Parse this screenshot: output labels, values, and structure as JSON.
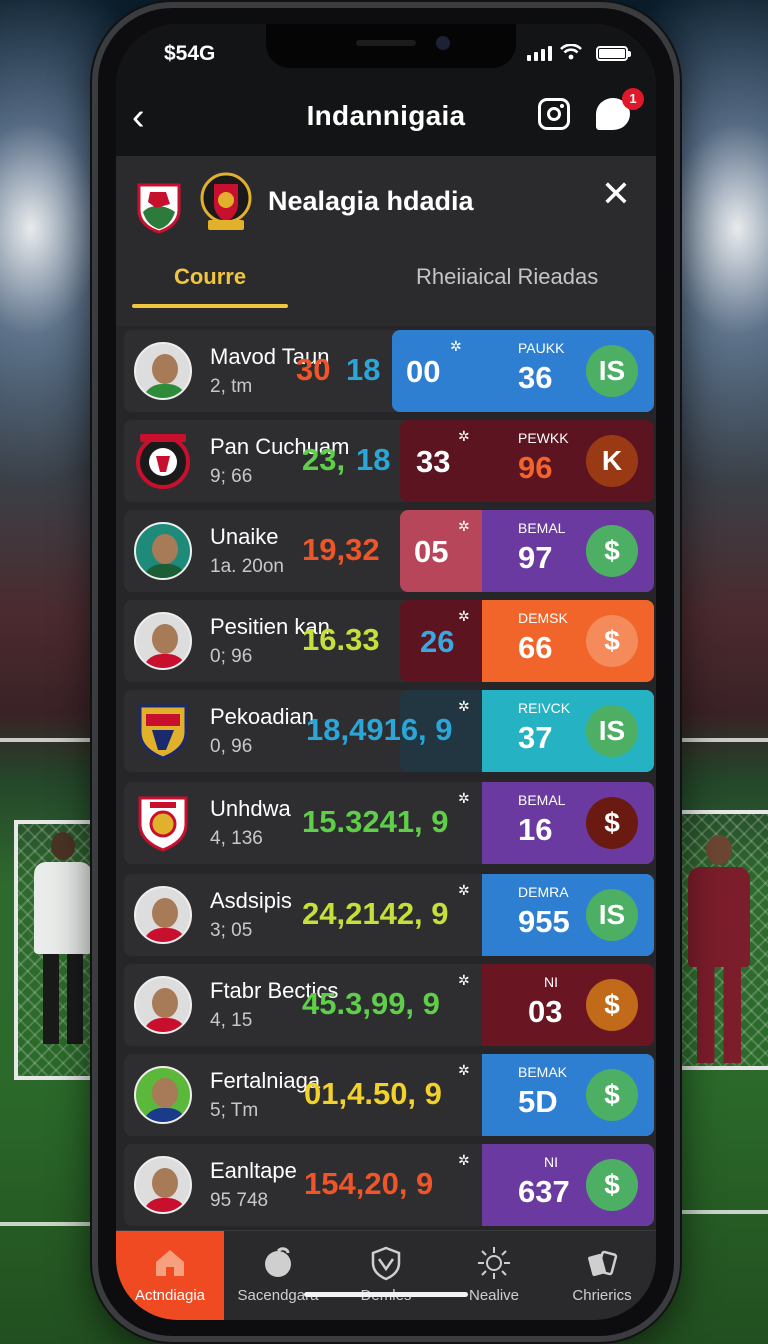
{
  "status": {
    "time": "$54G"
  },
  "nav": {
    "title": "Indannigaia",
    "badge_count": "1"
  },
  "header": {
    "title": "Nealagia hdadia"
  },
  "tabs": [
    {
      "label": "Courre",
      "active": true
    },
    {
      "label": "Rheiiaical Rieadas",
      "active": false
    }
  ],
  "rows": [
    {
      "name": "Mavod Taun",
      "sub": "2, tm",
      "stat_a": "30",
      "stat_b": "18",
      "num_a": "00",
      "label_b": "PAUKK",
      "value_b": "36",
      "btn": "IS"
    },
    {
      "name": "Pan Cuchuam",
      "sub": "9; 66",
      "stat_a": "23,",
      "stat_b": "18",
      "num_a": "33",
      "label_b": "PEWKK",
      "value_b": "96",
      "btn": "K"
    },
    {
      "name": "Unaike",
      "sub": "1a. 20on",
      "stat_a": "19,32",
      "stat_b": "",
      "num_a": "05",
      "label_b": "BEMAL",
      "value_b": "97",
      "btn": "$"
    },
    {
      "name": "Pesitien kan",
      "sub": "0; 96",
      "stat_a": "16.33",
      "stat_b": "",
      "num_a": "26",
      "label_b": "DEMSK",
      "value_b": "66",
      "btn": "$"
    },
    {
      "name": "Pekoadian",
      "sub": "0, 96",
      "stat_a": "18,4916, 9",
      "stat_b": "",
      "num_a": "",
      "label_b": "REIVCK",
      "value_b": "37",
      "btn": "IS"
    },
    {
      "name": "Unhdwa",
      "sub": "4, 136",
      "stat_a": "15.3241, 9",
      "stat_b": "",
      "num_a": "",
      "label_b": "BEMAL",
      "value_b": "16",
      "btn": "$"
    },
    {
      "name": "Asdsipis",
      "sub": "3; 05",
      "stat_a": "24,2142, 9",
      "stat_b": "",
      "num_a": "",
      "label_b": "DEMRA",
      "value_b": "955",
      "btn": "IS"
    },
    {
      "name": "Ftabr Bectics",
      "sub": "4, 15",
      "stat_a": "45.3,99, 9",
      "stat_b": "",
      "num_a": "",
      "label_b": "NI",
      "value_b": "03",
      "btn": "$"
    },
    {
      "name": "Fertalniaga",
      "sub": "5; Tm",
      "stat_a": "01,4.50, 9",
      "stat_b": "",
      "num_a": "",
      "label_b": "BEMAK",
      "value_b": "5D",
      "btn": "$"
    },
    {
      "name": "Eanltape",
      "sub": "95 748",
      "stat_a": "154,20, 9",
      "stat_b": "",
      "num_a": "",
      "label_b": "NI",
      "value_b": "637",
      "btn": "$"
    }
  ],
  "bottom_nav": [
    {
      "label": "Actndiagia",
      "icon": "home-icon",
      "active": true
    },
    {
      "label": "Sacendgara",
      "icon": "ball-icon",
      "active": false
    },
    {
      "label": "Demles",
      "icon": "shield-icon",
      "active": false
    },
    {
      "label": "Nealive",
      "icon": "sun-icon",
      "active": false
    },
    {
      "label": "Chrierics",
      "icon": "cards-icon",
      "active": false
    }
  ],
  "colors": {
    "accent_tab": "#f0c640",
    "nav_active": "#f04a23",
    "blue": "#2e7fd1",
    "orange": "#f2652a",
    "purple": "#6a3aa0",
    "cyan": "#25b3c4",
    "maroon": "#6a1622",
    "green_btn": "#4caf64"
  }
}
